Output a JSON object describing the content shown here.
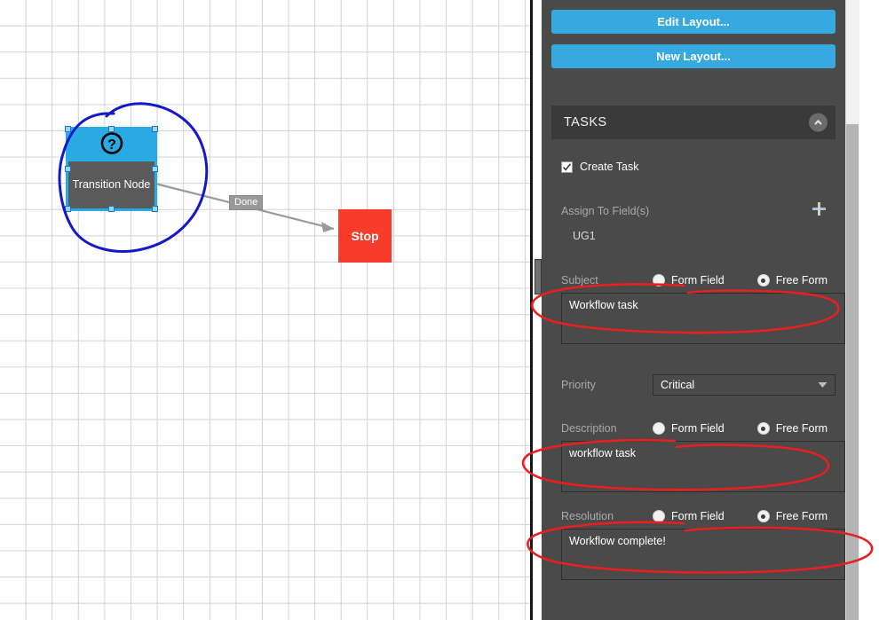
{
  "canvas": {
    "nodes": [
      {
        "id": "transition-node",
        "label": "Transition Node",
        "icon": "question-mark-circle-icon",
        "header_color": "#29aae2",
        "body_color": "#5a5a5a",
        "selected": true
      },
      {
        "id": "stop-node",
        "label": "Stop",
        "color": "#f93b2b"
      }
    ],
    "edges": [
      {
        "label": "Done",
        "from": "transition-node",
        "to": "stop-node"
      }
    ],
    "annotations": [
      {
        "shape": "blue-circle-around-transition-node",
        "color": "#1418c8"
      },
      {
        "shape": "red-ellipse-around-subject-row",
        "color": "#e81f1f"
      },
      {
        "shape": "red-ellipse-around-description-row",
        "color": "#e81f1f"
      },
      {
        "shape": "red-ellipse-around-resolution-row",
        "color": "#e81f1f"
      }
    ]
  },
  "panel": {
    "buttons": {
      "edit_layout": "Edit Layout...",
      "new_layout": "New Layout..."
    },
    "section": {
      "title": "TASKS",
      "collapse_icon": "chevron-up-icon"
    },
    "create_task": {
      "label": "Create Task",
      "checked": true
    },
    "assign": {
      "label": "Assign To Field(s)",
      "add_icon": "plus-icon",
      "values": [
        "UG1"
      ]
    },
    "subject": {
      "label": "Subject",
      "option_form_field": "Form Field",
      "option_free_form": "Free Form",
      "selected": "Free Form",
      "value": "Workflow task"
    },
    "priority": {
      "label": "Priority",
      "value": "Critical",
      "caret_icon": "chevron-down-icon"
    },
    "description": {
      "label": "Description",
      "option_form_field": "Form Field",
      "option_free_form": "Free Form",
      "selected": "Free Form",
      "value": "workflow task"
    },
    "resolution": {
      "label": "Resolution",
      "option_form_field": "Form Field",
      "option_free_form": "Free Form",
      "selected": "Free Form",
      "value": "Workflow complete!"
    },
    "colors": {
      "panel_bg": "#4a4a4a",
      "section_bg": "#3a3a3a",
      "accent_blue": "#36a9e1",
      "annotation_red": "#e81f1f",
      "annotation_blue": "#1418c8"
    }
  }
}
